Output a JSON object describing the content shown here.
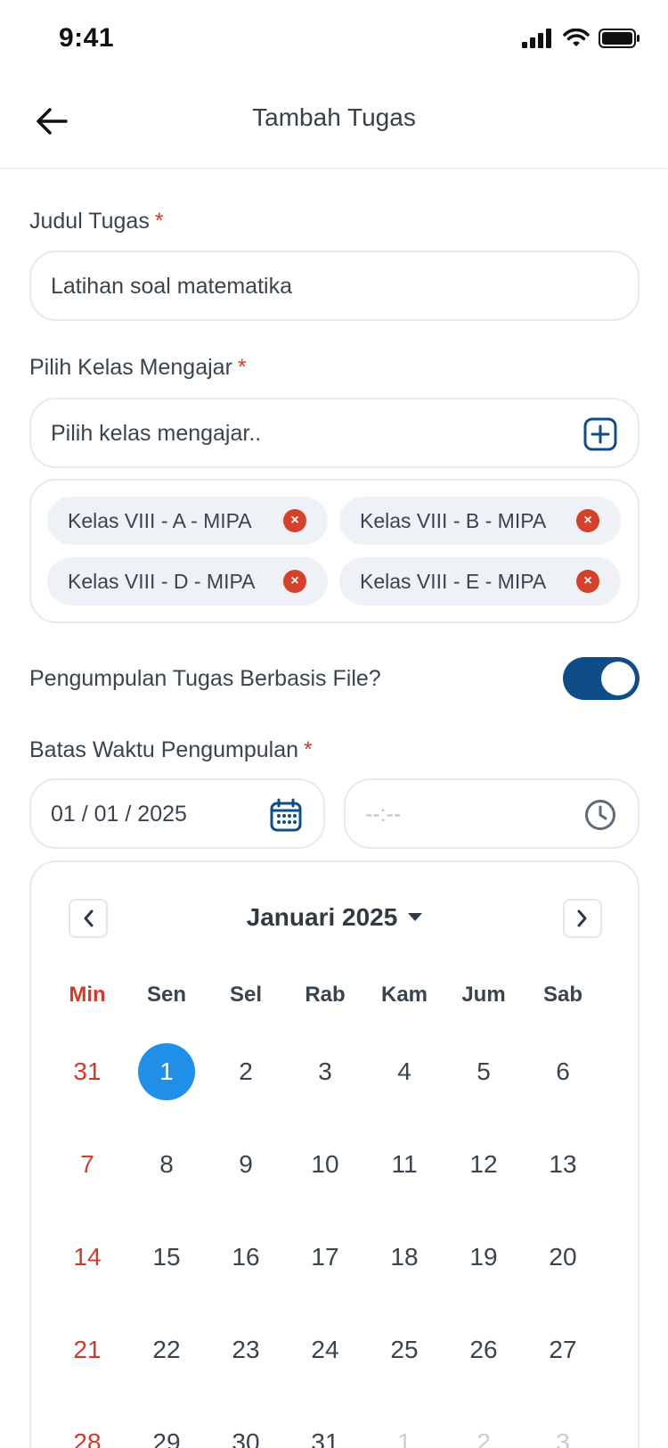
{
  "status_bar": {
    "time": "9:41"
  },
  "header": {
    "title": "Tambah Tugas"
  },
  "form": {
    "title_field": {
      "label": "Judul Tugas",
      "required_mark": "*",
      "value": "Latihan soal matematika"
    },
    "class_field": {
      "label": "Pilih Kelas Mengajar",
      "required_mark": "*",
      "placeholder": "Pilih kelas mengajar..",
      "chips": [
        {
          "label": "Kelas VIII - A - MIPA"
        },
        {
          "label": "Kelas VIII - B - MIPA"
        },
        {
          "label": "Kelas VIII - D - MIPA"
        },
        {
          "label": "Kelas VIII - E - MIPA"
        }
      ],
      "chip_remove_glyph": "×"
    },
    "file_toggle": {
      "label": "Pengumpulan Tugas Berbasis File?",
      "on": true
    },
    "deadline": {
      "label": "Batas Waktu Pengumpulan",
      "required_mark": "*",
      "date_value": "01 / 01 / 2025",
      "time_placeholder": "--:--"
    }
  },
  "calendar": {
    "month_label": "Januari 2025",
    "weekdays": [
      "Min",
      "Sen",
      "Sel",
      "Rab",
      "Kam",
      "Jum",
      "Sab"
    ],
    "rows": [
      [
        "31",
        "1",
        "2",
        "3",
        "4",
        "5",
        "6"
      ],
      [
        "7",
        "8",
        "9",
        "10",
        "11",
        "12",
        "13"
      ],
      [
        "14",
        "15",
        "16",
        "17",
        "18",
        "19",
        "20"
      ],
      [
        "21",
        "22",
        "23",
        "24",
        "25",
        "26",
        "27"
      ],
      [
        "28",
        "29",
        "30",
        "31",
        "1",
        "2",
        "3"
      ]
    ],
    "selected_day": "1",
    "muted_last_row_from_index": 4
  },
  "colors": {
    "accent": "#0f4c8a",
    "selected_day": "#1f8fe8",
    "danger": "#d23b2a"
  }
}
